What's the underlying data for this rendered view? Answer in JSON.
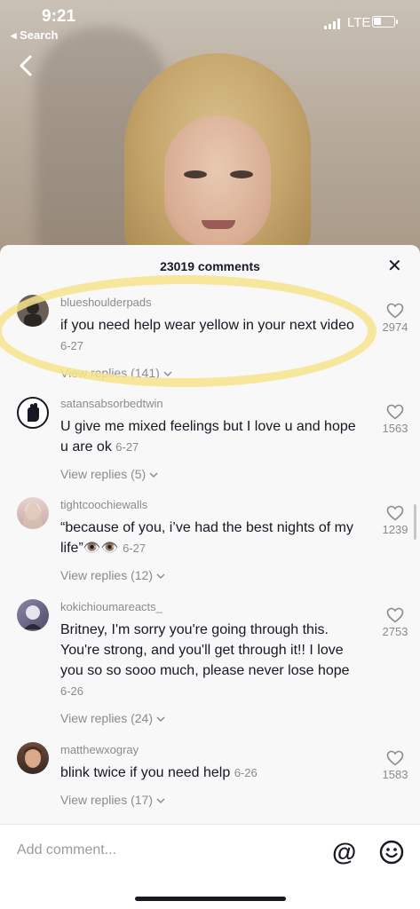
{
  "status_bar": {
    "time": "9:21",
    "back_app": "◂ Search",
    "network": "LTE"
  },
  "comments_panel": {
    "count_label": "23019 comments",
    "close_label": "✕"
  },
  "comments": [
    {
      "username": "blueshoulderpads",
      "text": "if you need help wear yellow in your next video",
      "date": "6-27",
      "replies": "View replies (141)",
      "likes": "2974"
    },
    {
      "username": "satansabsorbedtwin",
      "text": "U give me mixed feelings but I love u and hope u are ok",
      "date": "6-27",
      "replies": "View replies (5)",
      "likes": "1563"
    },
    {
      "username": "tightcoochiewalls",
      "text": "“because of you, i’ve had the best nights of my life”👁️👁️",
      "date": "6-27",
      "replies": "View replies (12)",
      "likes": "1239"
    },
    {
      "username": "kokichioumareacts_",
      "text": "Britney, I'm sorry you're going through this. You're strong, and you'll get through it!! I love you so so sooo much, please never lose hope",
      "date": "6-26",
      "replies": "View replies (24)",
      "likes": "2753"
    },
    {
      "username": "matthewxogray",
      "text": "blink twice if you need help",
      "date": "6-26",
      "replies": "View replies (17)",
      "likes": "1583"
    }
  ],
  "input": {
    "placeholder": "Add comment...",
    "at_symbol": "@"
  },
  "icons": {
    "back": "chevron-left-icon",
    "like": "heart-outline-icon",
    "mention": "at-icon",
    "emoji": "smiley-icon"
  },
  "colors": {
    "highlight_circle": "#f6e48c",
    "muted_text": "#8a8b91",
    "primary_text": "#161823"
  }
}
